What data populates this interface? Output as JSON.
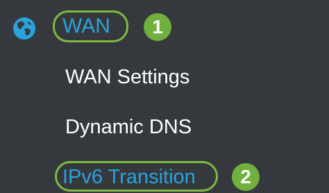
{
  "nav": {
    "section": {
      "icon": "globe-icon",
      "label": "WAN",
      "step": "1"
    },
    "items": [
      {
        "label": "WAN Settings"
      },
      {
        "label": "Dynamic DNS"
      },
      {
        "label": "IPv6 Transition",
        "step": "2"
      }
    ]
  },
  "colors": {
    "background": "#35393e",
    "link": "#2aa3dc",
    "highlight": "#7dbb42",
    "badge": "#6fb03e",
    "text": "#ffffff"
  }
}
